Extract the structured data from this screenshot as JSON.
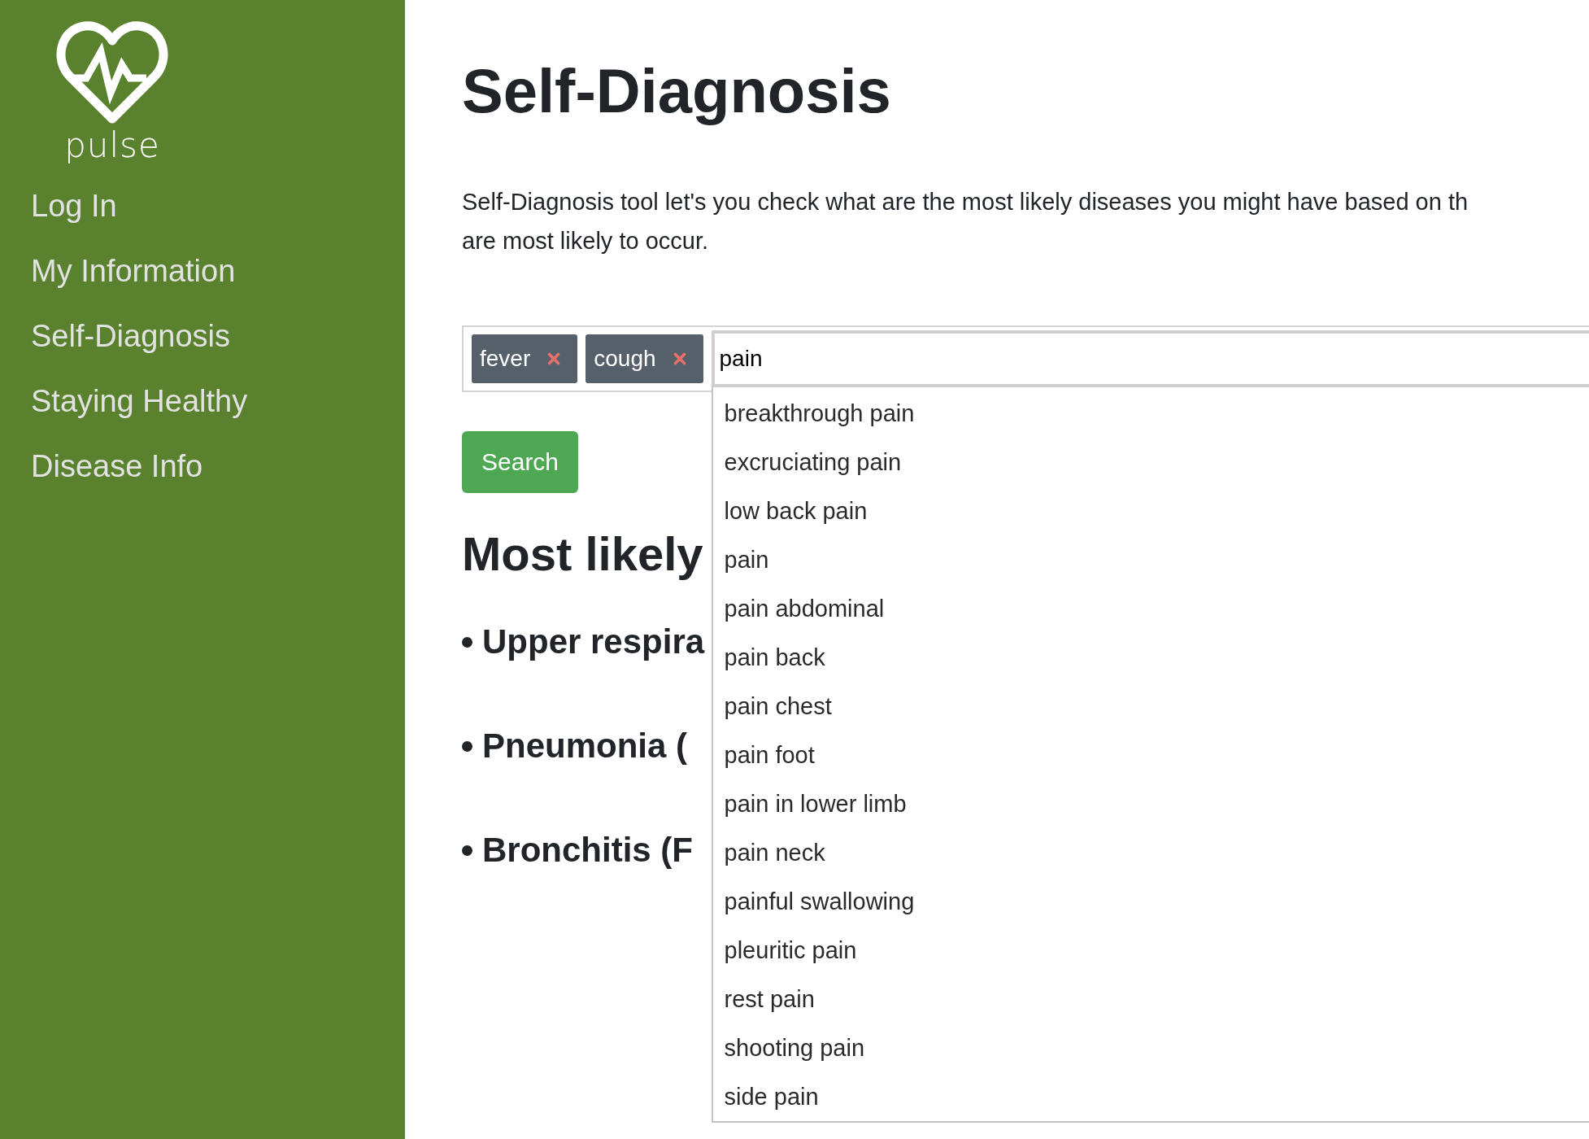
{
  "sidebar": {
    "logo_text": "pulse",
    "items": [
      {
        "label": "Log In"
      },
      {
        "label": "My Information"
      },
      {
        "label": "Self-Diagnosis"
      },
      {
        "label": "Staying Healthy"
      },
      {
        "label": "Disease Info"
      }
    ]
  },
  "title": "Self-Diagnosis",
  "description": "Self-Diagnosis tool let's you check what are the most likely diseases you might have based on th\nare most likely to occur.",
  "symptom_input": {
    "tags": [
      {
        "label": "fever"
      },
      {
        "label": "cough"
      }
    ],
    "value": "pain",
    "suggestions": [
      "breakthrough pain",
      "excruciating pain",
      "low back pain",
      "pain",
      "pain abdominal",
      "pain back",
      "pain chest",
      "pain foot",
      "pain in lower limb",
      "pain neck",
      "painful swallowing",
      "pleuritic pain",
      "rest pain",
      "shooting pain",
      "side pain"
    ]
  },
  "search_button": "Search",
  "results": {
    "heading": "Most likely",
    "items": [
      "Upper respira",
      "Pneumonia (",
      "Bronchitis (F"
    ]
  }
}
